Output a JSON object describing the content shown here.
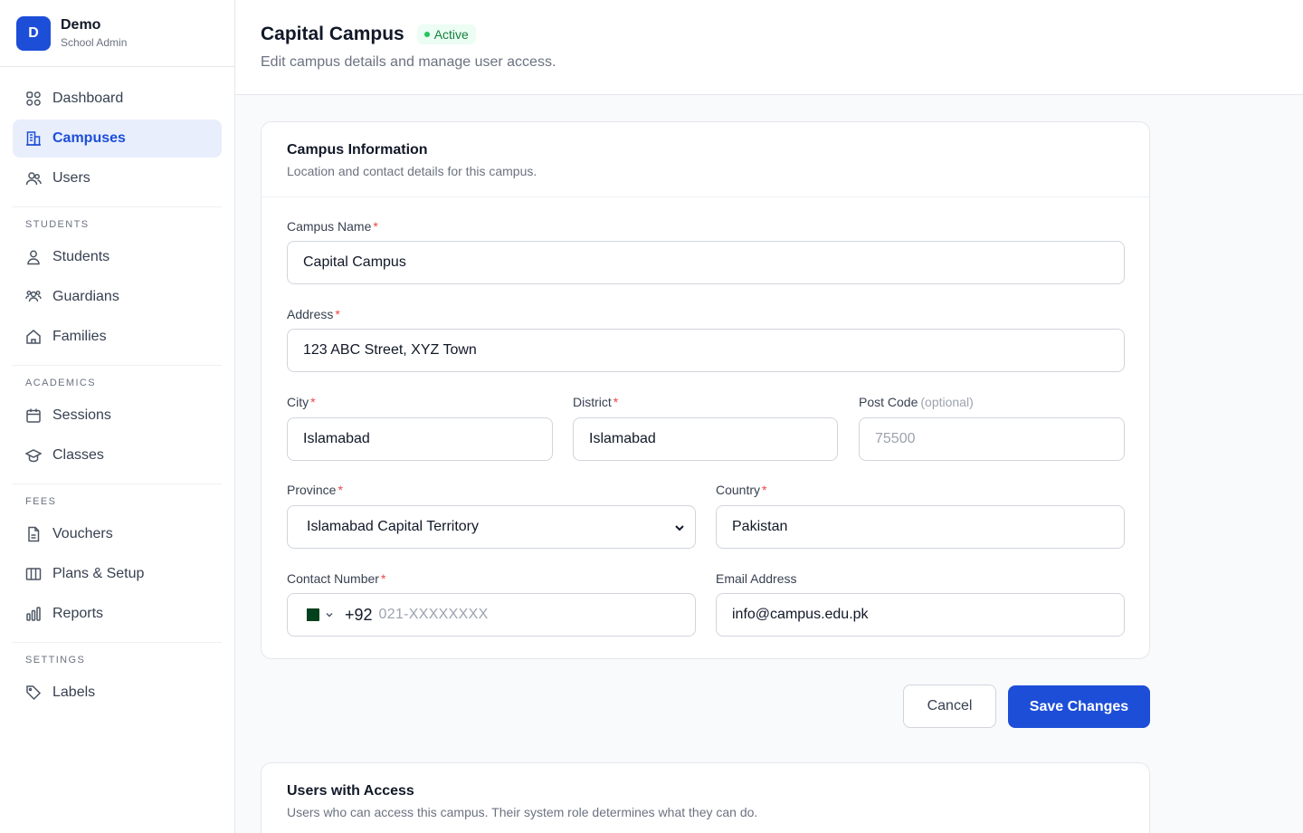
{
  "brand": {
    "initial": "D",
    "name": "Demo",
    "role": "School Admin"
  },
  "nav": {
    "top": [
      {
        "label": "Dashboard",
        "icon": "dashboard-icon"
      },
      {
        "label": "Campuses",
        "icon": "building-icon",
        "active": true
      },
      {
        "label": "Users",
        "icon": "users-icon"
      }
    ],
    "sections": [
      {
        "heading": "STUDENTS",
        "items": [
          {
            "label": "Students",
            "icon": "user-icon"
          },
          {
            "label": "Guardians",
            "icon": "guardians-icon"
          },
          {
            "label": "Families",
            "icon": "home-icon"
          }
        ]
      },
      {
        "heading": "ACADEMICS",
        "items": [
          {
            "label": "Sessions",
            "icon": "calendar-icon"
          },
          {
            "label": "Classes",
            "icon": "graduation-cap-icon"
          }
        ]
      },
      {
        "heading": "FEES",
        "items": [
          {
            "label": "Vouchers",
            "icon": "document-icon"
          },
          {
            "label": "Plans & Setup",
            "icon": "columns-icon"
          },
          {
            "label": "Reports",
            "icon": "bar-chart-icon"
          }
        ]
      },
      {
        "heading": "SETTINGS",
        "items": [
          {
            "label": "Labels",
            "icon": "tag-icon"
          }
        ]
      }
    ]
  },
  "header": {
    "title": "Capital Campus",
    "status": "Active",
    "subtitle": "Edit campus details and manage user access."
  },
  "info_card": {
    "title": "Campus Information",
    "description": "Location and contact details for this campus.",
    "fields": {
      "campus_name": {
        "label": "Campus Name",
        "required": "*",
        "value": "Capital Campus"
      },
      "address": {
        "label": "Address",
        "required": "*",
        "value": "123 ABC Street, XYZ Town"
      },
      "city": {
        "label": "City",
        "required": "*",
        "value": "Islamabad"
      },
      "district": {
        "label": "District",
        "required": "*",
        "value": "Islamabad"
      },
      "post_code": {
        "label": "Post Code",
        "optional": "(optional)",
        "placeholder": "75500"
      },
      "province": {
        "label": "Province",
        "required": "*",
        "value": "Islamabad Capital Territory"
      },
      "country": {
        "label": "Country",
        "required": "*",
        "value": "Pakistan"
      },
      "contact": {
        "label": "Contact Number",
        "required": "*",
        "prefix": "+92",
        "placeholder": "021-XXXXXXXX"
      },
      "email": {
        "label": "Email Address",
        "value": "info@campus.edu.pk"
      }
    }
  },
  "actions": {
    "cancel": "Cancel",
    "save": "Save Changes"
  },
  "users_card": {
    "title": "Users with Access",
    "description": "Users who can access this campus. Their system role determines what they can do."
  },
  "colors": {
    "primary": "#1d4ed8",
    "active_bg": "#e8eefc",
    "success": "#15803d",
    "required": "#ef4444"
  }
}
